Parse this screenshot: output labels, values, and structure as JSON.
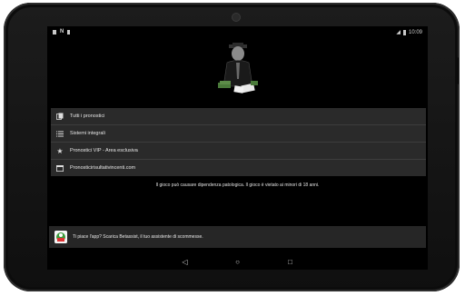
{
  "status_bar": {
    "time": "10:09",
    "left_icons": [
      "screen-icon",
      "n-icon",
      "notification-icon"
    ],
    "right_icons": [
      "signal-off-icon",
      "battery-icon"
    ]
  },
  "menu": {
    "items": [
      {
        "label": "Tutti i pronostici",
        "icon": "pages-icon"
      },
      {
        "label": "Sistemi integrali",
        "icon": "list-icon"
      },
      {
        "label": "Pronostici VIP - Area esclusiva",
        "icon": "star-icon"
      },
      {
        "label": "Pronosticirisultativincenti.com",
        "icon": "web-icon"
      }
    ]
  },
  "disclaimer": "Il gioco può causare dipendenza patologica. Il gioco è vietato ai minori di 18 anni.",
  "banner": {
    "text": "Ti piace l'app? Scarica Betassist, il tuo assistente di scommesse.",
    "icon": "betassist-app-icon"
  },
  "nav": [
    "back-icon",
    "home-icon",
    "recents-icon"
  ],
  "colors": {
    "screen_bg": "#000000",
    "row_bg": "#2a2a2a",
    "text": "#e6e6e6"
  }
}
